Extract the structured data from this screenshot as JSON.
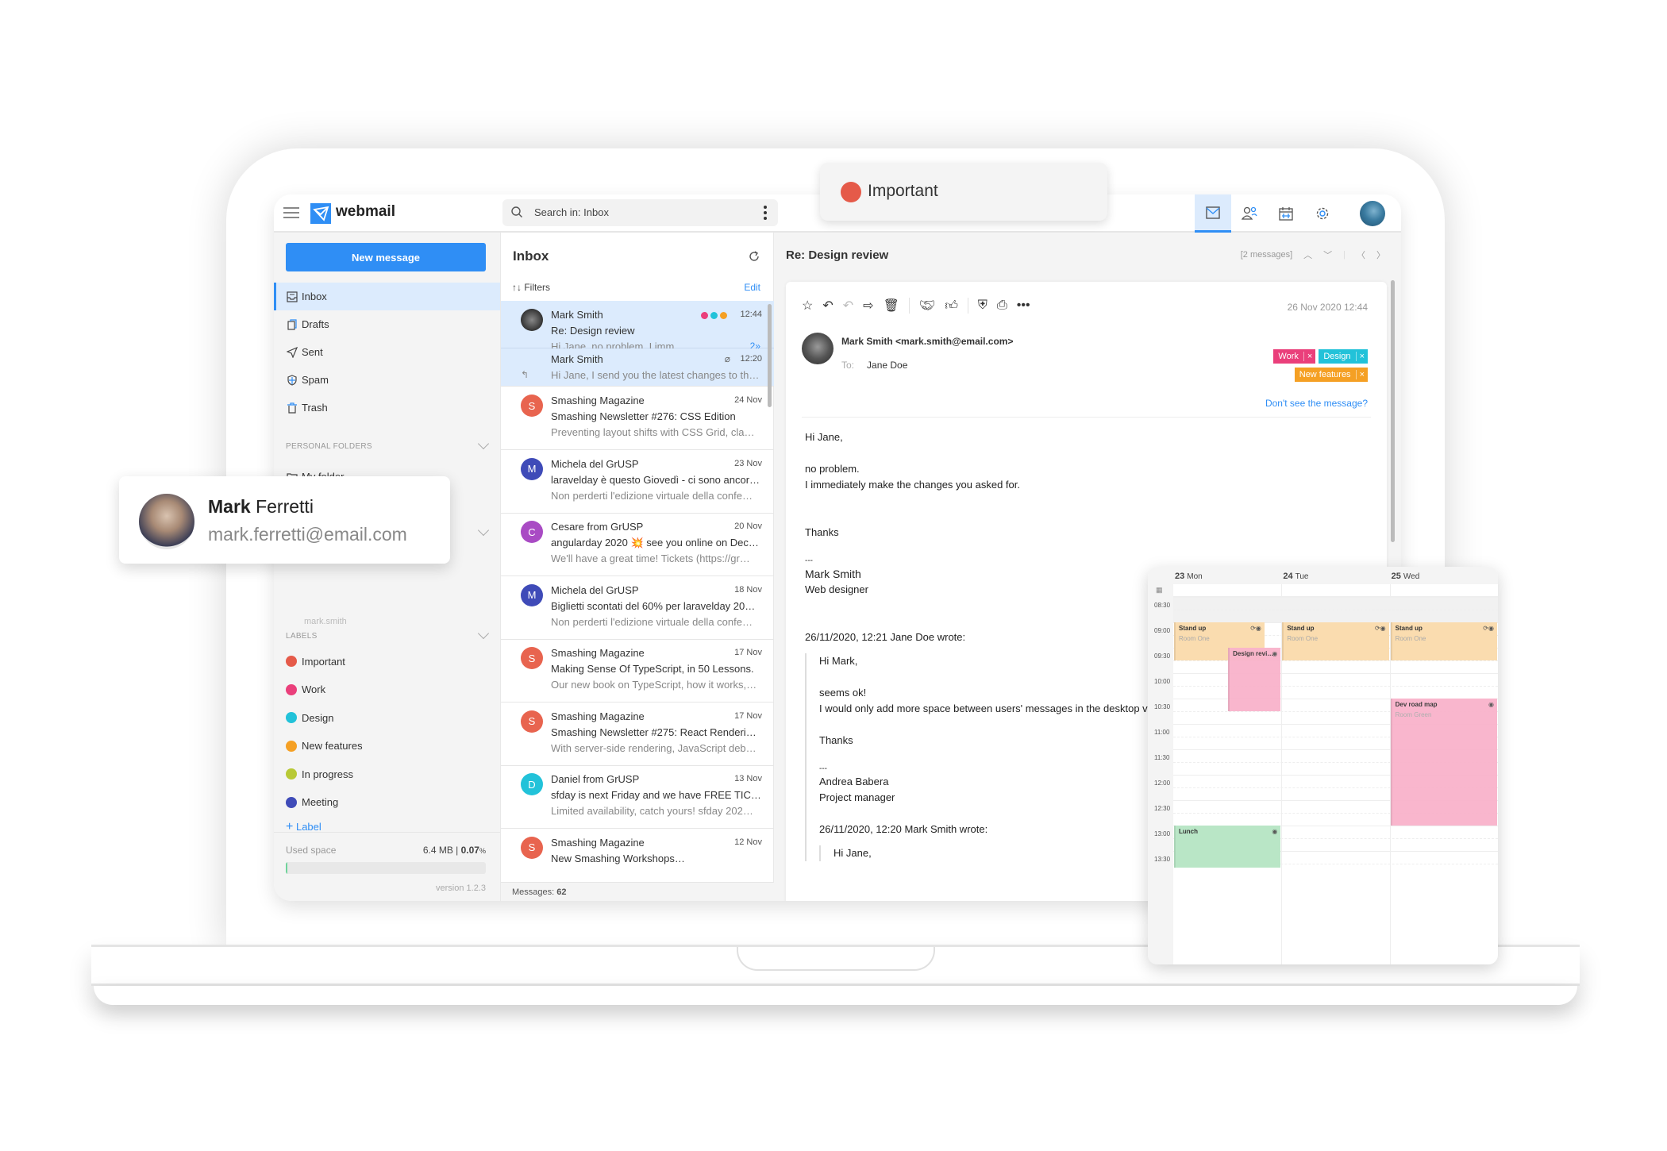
{
  "app": {
    "brand": "webmail",
    "search_placeholder": "Search in: Inbox"
  },
  "top_nav": [
    {
      "name": "mail",
      "icon": "mail-icon",
      "active": true
    },
    {
      "name": "contacts",
      "icon": "contacts-icon",
      "active": false
    },
    {
      "name": "calendar",
      "icon": "calendar-icon",
      "active": false
    },
    {
      "name": "settings",
      "icon": "gear-icon",
      "active": false
    }
  ],
  "sidebar": {
    "new_message": "New message",
    "folders": [
      {
        "label": "Inbox",
        "icon": "inbox-icon",
        "active": true
      },
      {
        "label": "Drafts",
        "icon": "drafts-icon",
        "active": false
      },
      {
        "label": "Sent",
        "icon": "sent-icon",
        "active": false
      },
      {
        "label": "Spam",
        "icon": "spam-icon",
        "active": false
      },
      {
        "label": "Trash",
        "icon": "trash-icon",
        "active": false
      }
    ],
    "personal_folders_title": "PERSONAL FOLDERS",
    "personal_folders": [
      {
        "label": "My folder",
        "icon": "folder-icon"
      }
    ],
    "account_hint": "mark.smith",
    "labels_title": "LABELS",
    "labels": [
      {
        "label": "Important",
        "color": "#e55a49"
      },
      {
        "label": "Work",
        "color": "#ea3f7b"
      },
      {
        "label": "Design",
        "color": "#22c2d9"
      },
      {
        "label": "New features",
        "color": "#f5a024"
      },
      {
        "label": "In progress",
        "color": "#b8c936"
      },
      {
        "label": "Meeting",
        "color": "#3f4bb8"
      }
    ],
    "add_label": "Label",
    "used_space_label": "Used space",
    "used_space_size": "6.4 MB",
    "used_space_percent": "0.07",
    "used_space_percent_unit": "%",
    "used_space_fraction": 0.0007,
    "version": "version 1.2.3"
  },
  "list": {
    "title": "Inbox",
    "filters": "Filters",
    "edit": "Edit",
    "message_count_label": "Messages:",
    "message_count": "62",
    "thread": {
      "from": "Mark Smith",
      "subject": "Re: Design review",
      "preview": "Hi Jane, no problem. I imm…",
      "time": "12:44",
      "count": "2",
      "label_colors": [
        "#ea3f7b",
        "#22c2d9",
        "#f5a024"
      ],
      "child": {
        "from": "Mark Smith",
        "preview": "Hi Jane, I send you the latest changes to th…",
        "time": "12:20"
      }
    },
    "messages": [
      {
        "from": "Smashing Magazine",
        "subject": "Smashing Newsletter #276: CSS Edition",
        "preview": "Preventing layout shifts with CSS Grid, cla…",
        "date": "24 Nov",
        "initial": "S",
        "color": "#e8644f"
      },
      {
        "from": "Michela del GrUSP",
        "subject": "laravelday è questo Giovedì - ci sono ancor…",
        "preview": "Non perderti l'edizione virtuale della confe…",
        "date": "23 Nov",
        "initial": "M",
        "color": "#3f4bb8"
      },
      {
        "from": "Cesare from GrUSP",
        "subject": "angularday 2020 💥 see you online on Dec…",
        "preview": "We'll have a great time!  Tickets (https://gr…",
        "date": "20 Nov",
        "initial": "C",
        "color": "#a94bc4"
      },
      {
        "from": "Michela del GrUSP",
        "subject": "Biglietti scontati del 60% per laravelday 20…",
        "preview": "Non perderti l'edizione virtuale della confe…",
        "date": "18 Nov",
        "initial": "M",
        "color": "#3f4bb8"
      },
      {
        "from": "Smashing Magazine",
        "subject": "Making Sense Of TypeScript, in 50 Lessons.",
        "preview": "Our new book on TypeScript, how it works,…",
        "date": "17 Nov",
        "initial": "S",
        "color": "#e8644f"
      },
      {
        "from": "Smashing Magazine",
        "subject": "Smashing Newsletter #275: React Renderin…",
        "preview": "With server-side rendering, JavaScript deb…",
        "date": "17 Nov",
        "initial": "S",
        "color": "#e8644f"
      },
      {
        "from": "Daniel from GrUSP",
        "subject": "sfday is next Friday and we have FREE TICK…",
        "preview": "Limited availability, catch yours!  sfday 202…",
        "date": "13 Nov",
        "initial": "D",
        "color": "#22c2d9"
      },
      {
        "from": "Smashing Magazine",
        "subject": "New Smashing Workshops…",
        "preview": "",
        "date": "12 Nov",
        "initial": "S",
        "color": "#e8644f"
      }
    ]
  },
  "reader": {
    "title": "Re: Design review",
    "thread_count": "[2 messages]",
    "date": "26 Nov 2020 12:44",
    "sender": "Mark Smith <mark.smith@email.com>",
    "to_label": "To:",
    "to": "Jane Doe",
    "tags": [
      {
        "label": "Work",
        "color": "#ea3f7b"
      },
      {
        "label": "Design",
        "color": "#22c2d9"
      },
      {
        "label": "New features",
        "color": "#f5a024"
      }
    ],
    "dont_see": "Don't see the message?",
    "body": {
      "greeting": "Hi Jane,",
      "l1": "no problem.",
      "l2": "I immediately make the changes you asked for.",
      "thanks": "Thanks",
      "sep": "---",
      "sig_name": "Mark Smith",
      "sig_role": "Web designer",
      "quote_header": "26/11/2020, 12:21 Jane Doe wrote:",
      "q_greeting": "Hi Mark,",
      "q_l1": "seems ok!",
      "q_l2": "I would only add more space between users' messages in the desktop version.",
      "q_thanks": "Thanks",
      "q_sep": "---",
      "q_sig_name": "Andrea Babera",
      "q_sig_role": "Project manager",
      "q2_header": "26/11/2020, 12:20 Mark Smith  wrote:",
      "q2_greeting": "Hi Jane,"
    }
  },
  "overlays": {
    "label_chip": {
      "label": "Important",
      "color": "#e55a49"
    },
    "person": {
      "first": "Mark",
      "last": "Ferretti",
      "email": "mark.ferretti@email.com"
    }
  },
  "calendar": {
    "days": [
      {
        "num": "23",
        "name": "Mon"
      },
      {
        "num": "24",
        "name": "Tue"
      },
      {
        "num": "25",
        "name": "Wed"
      }
    ],
    "times": [
      "08:30",
      "09:00",
      "09:30",
      "10:00",
      "10:30",
      "11:00",
      "11:30",
      "12:00",
      "12:30",
      "13:00",
      "13:30"
    ],
    "events": [
      {
        "title": "Stand up",
        "location": "Room One",
        "day": 0,
        "start": "09:00",
        "end": "09:45",
        "color": "#fadcaf",
        "recurring": true,
        "width": 0.85,
        "offset": 0
      },
      {
        "title": "Stand up",
        "location": "Room One",
        "day": 1,
        "start": "09:00",
        "end": "09:45",
        "color": "#fadcaf",
        "recurring": true,
        "width": 1,
        "offset": 0
      },
      {
        "title": "Stand up",
        "location": "Room One",
        "day": 2,
        "start": "09:00",
        "end": "09:45",
        "color": "#fadcaf",
        "recurring": true,
        "width": 1,
        "offset": 0
      },
      {
        "title": "Design revi…",
        "location": "",
        "day": 0,
        "start": "09:30",
        "end": "10:45",
        "color": "#f9b3cb",
        "recurring": false,
        "width": 0.5,
        "offset": 0.5
      },
      {
        "title": "Dev road map",
        "location": "Room Green",
        "day": 2,
        "start": "10:30",
        "end": "13:00",
        "color": "#f9b3cb",
        "recurring": false,
        "width": 1,
        "offset": 0
      },
      {
        "title": "Lunch",
        "location": "",
        "day": 0,
        "start": "13:00",
        "end": "13:50",
        "color": "#b9e6c6",
        "recurring": false,
        "width": 1,
        "offset": 0
      }
    ]
  }
}
